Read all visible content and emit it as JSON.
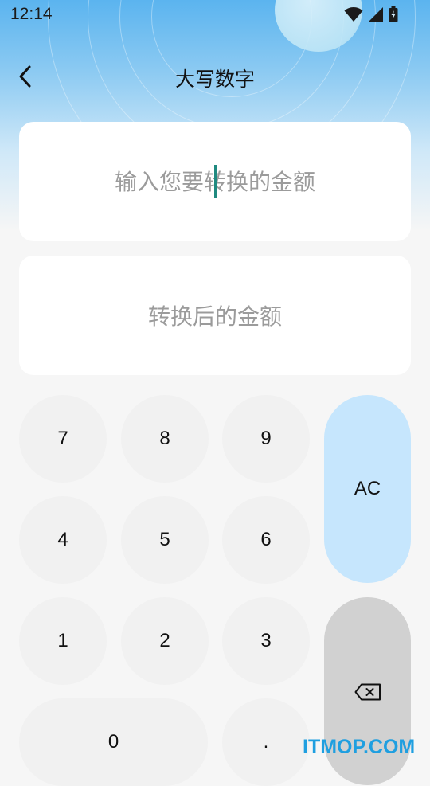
{
  "status_bar": {
    "time": "12:14",
    "icons": [
      "wifi-icon",
      "cellular-signal-icon",
      "battery-charging-icon"
    ]
  },
  "header": {
    "back_icon": "chevron-left-icon",
    "title": "大写数字"
  },
  "input": {
    "placeholder": "输入您要转换的金额",
    "value": ""
  },
  "output": {
    "placeholder": "转换后的金额"
  },
  "keypad": {
    "digits": [
      "7",
      "8",
      "9",
      "4",
      "5",
      "6",
      "1",
      "2",
      "3"
    ],
    "zero": "0",
    "dot": ".",
    "clear": "AC",
    "delete_icon": "backspace-icon"
  },
  "watermark": "ITMOP.COM",
  "colors": {
    "accent": "#c6e6fd",
    "delete_key": "#d1d1d1",
    "caret": "#1f8a80",
    "watermark": "#1f9fe0"
  }
}
